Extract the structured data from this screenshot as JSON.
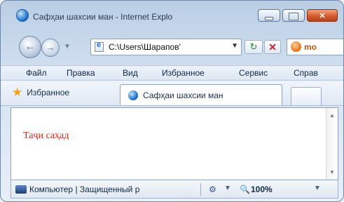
{
  "window": {
    "title": "Сафҳаи шахсии ман - Internet Explo"
  },
  "nav": {
    "back_icon": "back-arrow-icon",
    "forward_icon": "forward-arrow-icon",
    "history_dropdown": "▼",
    "address": "C:\\Users\\Шарапов'",
    "address_dropdown": "▼",
    "refresh_glyph": "↻",
    "stop_glyph": "✕",
    "search_text": "mo"
  },
  "menu": {
    "items": [
      "Файл",
      "Правка",
      "Вид",
      "Избранное",
      "Сервис",
      "Справ"
    ]
  },
  "tabs": {
    "favorites_label": "Избранное",
    "active_tab_label": "Сафҳаи шахсии ман"
  },
  "content": {
    "text": "Таҷи саҳад",
    "text_color": "#d22b1c"
  },
  "status": {
    "text": "Компьютер | Защищенный р",
    "zoom": "100%",
    "dropdown": "▼"
  },
  "colors": {
    "frame": "#c6d6ea",
    "close_button": "#d45a2e",
    "menu_text": "#0f2743"
  }
}
